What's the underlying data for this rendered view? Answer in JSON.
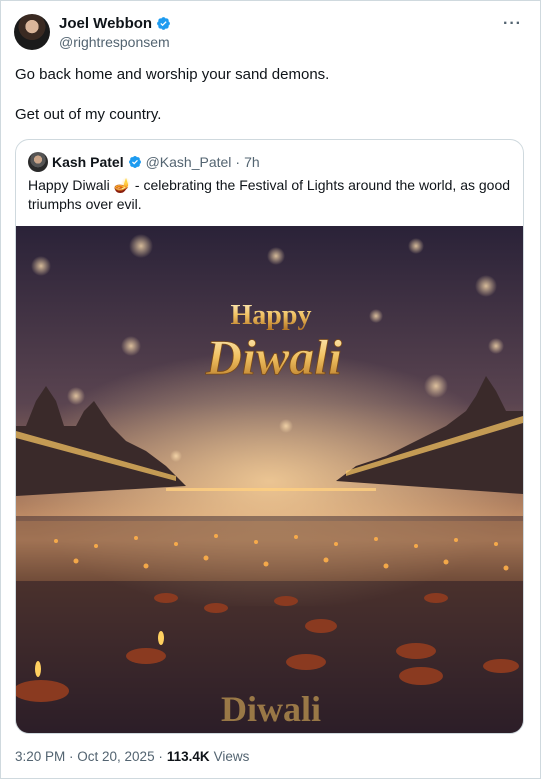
{
  "colors": {
    "verified": "#1d9bf0",
    "text": "#0f1419",
    "muted": "#536471",
    "border": "#cfd9de"
  },
  "tweet": {
    "author_name": "Joel Webbon",
    "handle": "@rightresponsem",
    "more_icon": "more-horizontal-icon",
    "text_lines": [
      "Go back home and worship your sand demons.",
      "Get out of my country."
    ],
    "timestamp": "3:20 PM · Oct 20, 2025 ·",
    "views_count": "113.4K",
    "views_label": "Views"
  },
  "quote": {
    "author_name": "Kash Patel",
    "handle": "@Kash_Patel",
    "separator": "·",
    "time": "7h",
    "text": "Happy Diwali 🪔 - celebrating the Festival of Lights around the world, as good triumphs over evil.",
    "image_text": {
      "line1": "Happy",
      "line2": "Diwali"
    }
  }
}
